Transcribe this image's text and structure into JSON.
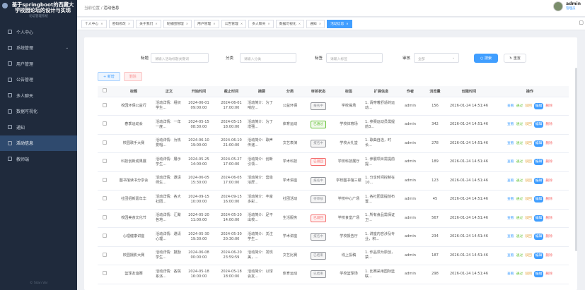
{
  "sidebar": {
    "title": "基于springboot的西藏大学校园论坛的设计与实现",
    "subtitle": "论坛管理系统",
    "footer": "© Silan Val",
    "items": [
      {
        "label": "个人中心"
      },
      {
        "label": "系统管理",
        "arrow": "⌄"
      },
      {
        "label": "用户管理"
      },
      {
        "label": "公告管理"
      },
      {
        "label": "多人聊天"
      },
      {
        "label": "数据可视化"
      },
      {
        "label": "通知"
      },
      {
        "label": "活动信息"
      },
      {
        "label": "教师端"
      }
    ]
  },
  "header": {
    "bc_home": "当前位置",
    "bc_sep": "/",
    "bc_current": "活动信息",
    "user_name": "admin",
    "user_role": "管理员"
  },
  "tabs": [
    {
      "label": "个人中心"
    },
    {
      "label": "密码修改"
    },
    {
      "label": "关于我们"
    },
    {
      "label": "轮播图管理"
    },
    {
      "label": "用户管理"
    },
    {
      "label": "公告管理"
    },
    {
      "label": "多人聊天"
    },
    {
      "label": "数据可视化"
    },
    {
      "label": "通知"
    },
    {
      "label": "活动信息"
    }
  ],
  "search": {
    "title_label": "标题",
    "title_placeholder": "请输入活动标题关键词",
    "cat_label": "分类",
    "cat_placeholder": "请输入分类",
    "tag_label": "标签",
    "tag_placeholder": "请输入标签",
    "status_label": "审核",
    "status_value": "全部",
    "search_btn": "搜索",
    "reset_btn": "重置"
  },
  "actions": {
    "add": "+ 新增",
    "delete": "删除"
  },
  "columns": [
    "标题",
    "正文",
    "开始时间",
    "截止时间",
    "摘要",
    "分类",
    "审核状态",
    "标签",
    "扩展信息",
    "作者",
    "浏览量",
    "创建时间",
    "操作"
  ],
  "ops": {
    "view": "查看",
    "pass": "通过",
    "reject": "驳回",
    "edit": "编辑",
    "delete": "删除"
  },
  "rows": [
    {
      "title": "校园环保公益行",
      "body": "活动详情：组织学生...",
      "start": "2024-06-01 09:00:00",
      "end": "2024-06-01 17:00:00",
      "summary": "活动简介：为了响应...",
      "cat": "公益环保",
      "status": "报名中",
      "tag": "学校操场",
      "ext": "1. 请穿着舒适的运动...",
      "author": "admin",
      "views": "156",
      "created": "2026-01-24 14:51:46"
    },
    {
      "title": "春季运动会",
      "body": "活动详情：一年一度...",
      "start": "2024-05-15 08:30:00",
      "end": "2024-05-15 18:00:00",
      "summary": "活动简介：为了增强...",
      "cat": "体育运动",
      "status": "已通过",
      "tag": "学校体育场",
      "ext": "1. 参赛运动员需提前3...",
      "author": "admin",
      "views": "342",
      "created": "2026-01-24 14:51:46"
    },
    {
      "title": "校园歌手大赛",
      "body": "活动详情：为热爱唱...",
      "start": "2024-06-10 19:00:00",
      "end": "2024-06-10 21:00:00",
      "summary": "活动简介：歌声传递...",
      "cat": "文艺表演",
      "status": "报名中",
      "tag": "学校大礼堂",
      "ext": "1. 歌曲自选，时长...",
      "author": "admin",
      "views": "278",
      "created": "2026-01-24 14:51:46"
    },
    {
      "title": "科技创新成果展",
      "body": "活动详情：展示学生...",
      "start": "2024-05-25 14:00:00",
      "end": "2024-05-27 17:00:00",
      "summary": "活动简介：创新引领...",
      "cat": "学术科技",
      "status": "已驳回",
      "tag": "学校科技展厅",
      "ext": "1. 参展项目需提前提...",
      "author": "admin",
      "views": "189",
      "created": "2026-01-24 14:51:46"
    },
    {
      "title": "图书馆读书分享会",
      "body": "活动详情：邀请师生...",
      "start": "2024-06-05 15:30:00",
      "end": "2024-06-05 17:00:00",
      "summary": "活动简介：营造浓厚...",
      "cat": "学术讲座",
      "status": "报名中",
      "tag": "学校图书馆三楼",
      "ext": "1. 分享时间控制在10...",
      "author": "admin",
      "views": "123",
      "created": "2026-01-24 14:51:46"
    },
    {
      "title": "社团招新嘉年华",
      "body": "活动详情：各大社团...",
      "start": "2024-09-15 10:00:00",
      "end": "2024-09-15 16:00:00",
      "summary": "活动简介：丰富多彩...",
      "cat": "社团活动",
      "status": "待审核",
      "tag": "学校中心广场",
      "ext": "1. 各社团需提前布置...",
      "author": "admin",
      "views": "45",
      "created": "2026-01-24 14:51:46"
    },
    {
      "title": "校园美食文化节",
      "body": "活动详情：汇聚各地...",
      "start": "2024-05-20 11:00:00",
      "end": "2024-05-20 14:00:00",
      "summary": "活动简介：足不出校...",
      "cat": "生活服务",
      "status": "已驳回",
      "tag": "学校食堂广场",
      "ext": "1. 所有食品需保证卫...",
      "author": "admin",
      "views": "567",
      "created": "2026-01-24 14:51:46"
    },
    {
      "title": "心理健康讲座",
      "body": "活动详情：邀请心理...",
      "start": "2024-05-30 19:30:00",
      "end": "2024-05-30 20:30:00",
      "summary": "活动简介：关注学生...",
      "cat": "学术讲座",
      "status": "报名中",
      "tag": "学校报告厅",
      "ext": "1. 讲座内容涉及专业，积...",
      "author": "admin",
      "views": "234",
      "created": "2026-01-24 14:51:46"
    },
    {
      "title": "校园摄影大赛",
      "body": "活动详情：鼓励学生...",
      "start": "2024-06-08 00:00:00",
      "end": "2024-06-20 23:59:59",
      "summary": "活动简介：发现美，...",
      "cat": "文艺比赛",
      "status": "已结束",
      "tag": "线上投稿",
      "ext": "1. 作品须为原创，禁...",
      "author": "admin",
      "views": "187",
      "created": "2026-01-24 14:51:46"
    },
    {
      "title": "篮球友谊赛",
      "body": "活动详情：各院系派...",
      "start": "2024-05-18 16:00:00",
      "end": "2024-05-18 18:00:00",
      "summary": "活动简介：以球会友...",
      "cat": "体育运动",
      "status": "已结束",
      "tag": "学校篮球场",
      "ext": "1. 比赛采用国际篮联...",
      "author": "admin",
      "views": "298",
      "created": "2026-01-24 14:51:46"
    }
  ],
  "status_colors": {
    "报名中": "#909399",
    "已通过": "#67c23a",
    "已驳回": "#f56c6c",
    "待审核": "#909399",
    "已结束": "#909399"
  }
}
